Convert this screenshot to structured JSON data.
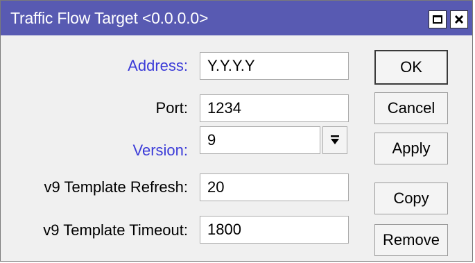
{
  "window": {
    "title": "Traffic Flow Target <0.0.0.0>",
    "titlebar_color": "#585ab2",
    "controls": [
      {
        "name": "maximize",
        "icon": "maximize-icon"
      },
      {
        "name": "close",
        "icon": "close-icon"
      }
    ]
  },
  "form": {
    "address": {
      "label": "Address:",
      "value": "Y.Y.Y.Y",
      "label_color": "#3b3bd8"
    },
    "port": {
      "label": "Port:",
      "value": "1234"
    },
    "version": {
      "label": "Version:",
      "value": "9",
      "label_color": "#3b3bd8",
      "dropdown_icon": "dropdown-arrow-icon"
    },
    "template_refresh": {
      "label": "v9 Template Refresh:",
      "value": "20"
    },
    "template_timeout": {
      "label": "v9 Template Timeout:",
      "value": "1800"
    }
  },
  "buttons": {
    "ok": "OK",
    "cancel": "Cancel",
    "apply": "Apply",
    "copy": "Copy",
    "remove": "Remove"
  }
}
